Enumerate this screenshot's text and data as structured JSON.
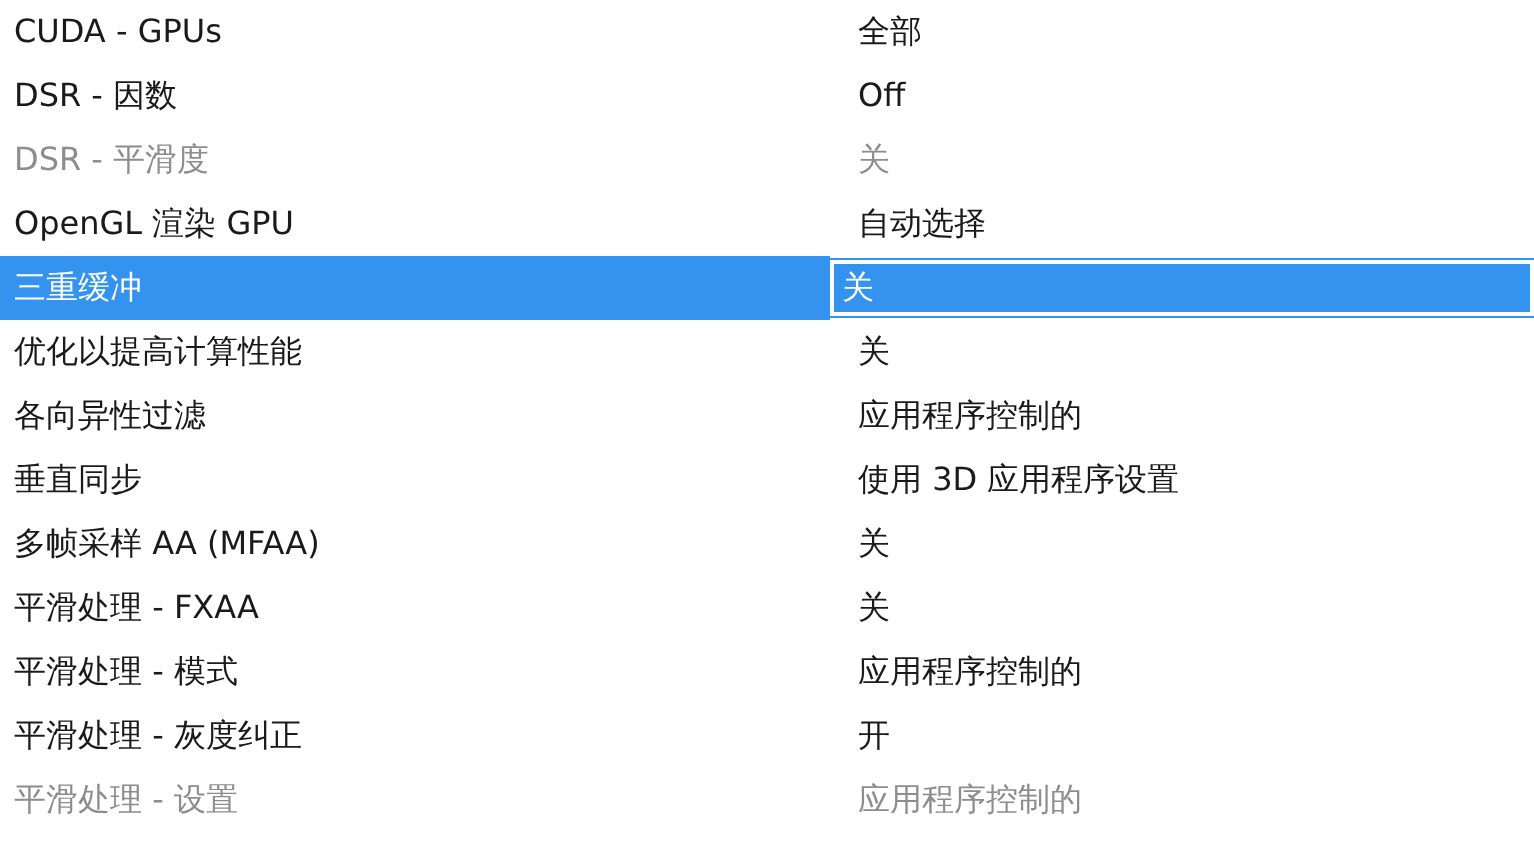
{
  "settings": [
    {
      "feature": "CUDA - GPUs",
      "value": "全部",
      "disabled": false,
      "selected": false
    },
    {
      "feature": "DSR - 因数",
      "value": "Off",
      "disabled": false,
      "selected": false
    },
    {
      "feature": "DSR - 平滑度",
      "value": "关",
      "disabled": true,
      "selected": false
    },
    {
      "feature": "OpenGL 渲染 GPU",
      "value": "自动选择",
      "disabled": false,
      "selected": false
    },
    {
      "feature": "三重缓冲",
      "value": "关",
      "disabled": false,
      "selected": true
    },
    {
      "feature": "优化以提高计算性能",
      "value": "关",
      "disabled": false,
      "selected": false
    },
    {
      "feature": "各向异性过滤",
      "value": "应用程序控制的",
      "disabled": false,
      "selected": false
    },
    {
      "feature": "垂直同步",
      "value": "使用 3D 应用程序设置",
      "disabled": false,
      "selected": false
    },
    {
      "feature": "多帧采样 AA (MFAA)",
      "value": "关",
      "disabled": false,
      "selected": false
    },
    {
      "feature": "平滑处理 - FXAA",
      "value": "关",
      "disabled": false,
      "selected": false
    },
    {
      "feature": "平滑处理 - 模式",
      "value": "应用程序控制的",
      "disabled": false,
      "selected": false
    },
    {
      "feature": "平滑处理 - 灰度纠正",
      "value": "开",
      "disabled": false,
      "selected": false
    },
    {
      "feature": "平滑处理 - 设置",
      "value": "应用程序控制的",
      "disabled": true,
      "selected": false
    }
  ]
}
